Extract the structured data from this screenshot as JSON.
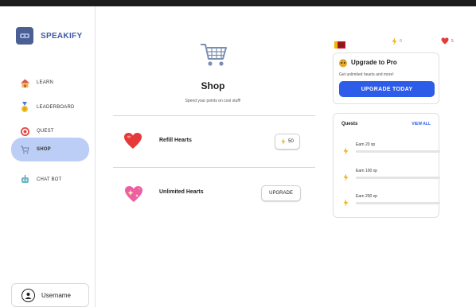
{
  "brand": {
    "name": "SPEAKIFY"
  },
  "nav": [
    {
      "label": "LEARN",
      "icon": "house-icon"
    },
    {
      "label": "LEADERBOARD",
      "icon": "medal-icon"
    },
    {
      "label": "QUEST",
      "icon": "target-icon"
    },
    {
      "label": "SHOP",
      "icon": "cart-icon",
      "active": true
    },
    {
      "label": "CHAT BOT",
      "icon": "robot-icon"
    }
  ],
  "user": {
    "label": "Username"
  },
  "shop": {
    "title": "Shop",
    "subtitle": "Spend your points on cool stuff!",
    "items": [
      {
        "label": "Refill Hearts",
        "button": "50",
        "icon": "heart-icon"
      },
      {
        "label": "Unlimited Hearts",
        "button": "UPGRADE",
        "icon": "sparkling-heart-icon"
      }
    ]
  },
  "stats": {
    "points": "0",
    "hearts": "5"
  },
  "pro": {
    "title": "Upgrade to Pro",
    "subtitle": "Get unlimited hearts and more!",
    "button": "UPGRADE TODAY"
  },
  "quests": {
    "title": "Quests",
    "view_all": "VIEW ALL",
    "items": [
      {
        "label": "Earn 20 xp",
        "progress": 0
      },
      {
        "label": "Earn 100 xp",
        "progress": 0
      },
      {
        "label": "Earn 200 xp",
        "progress": 0
      }
    ]
  },
  "colors": {
    "accent": "#2d5ce8",
    "active_nav": "#bccdf6",
    "brand": "#3d5aa8"
  }
}
